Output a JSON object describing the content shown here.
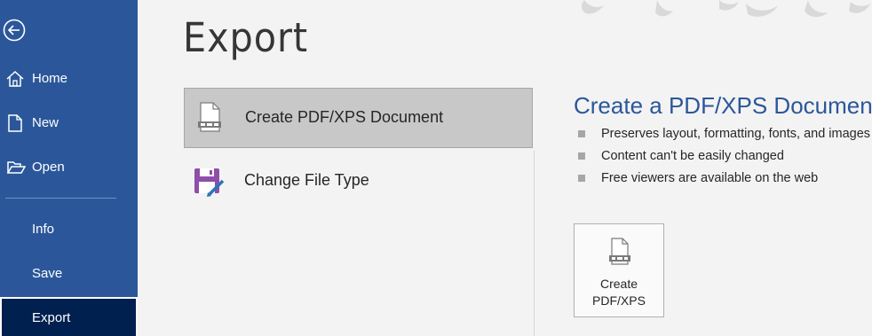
{
  "sidebar": {
    "back_icon": "back-arrow-circle-icon",
    "items": [
      {
        "label": "Home",
        "icon": "home-icon"
      },
      {
        "label": "New",
        "icon": "new-document-icon"
      },
      {
        "label": "Open",
        "icon": "open-folder-icon"
      },
      {
        "label": "Info"
      },
      {
        "label": "Save"
      },
      {
        "label": "Export"
      }
    ],
    "active": "Export",
    "color": "#2b579a",
    "active_color": "#002050"
  },
  "page": {
    "title": "Export"
  },
  "options": [
    {
      "label": "Create PDF/XPS Document",
      "icon": "pdf-document-icon",
      "selected": true
    },
    {
      "label": "Change File Type",
      "icon": "change-file-type-icon",
      "selected": false
    }
  ],
  "details": {
    "title": "Create a PDF/XPS Document",
    "bullets": [
      "Preserves layout, formatting, fonts, and images",
      "Content can't be easily changed",
      "Free viewers are available on the web"
    ],
    "button": {
      "line1": "Create",
      "line2": "PDF/XPS",
      "icon": "pdf-document-icon"
    },
    "accent_color": "#2b579a"
  }
}
